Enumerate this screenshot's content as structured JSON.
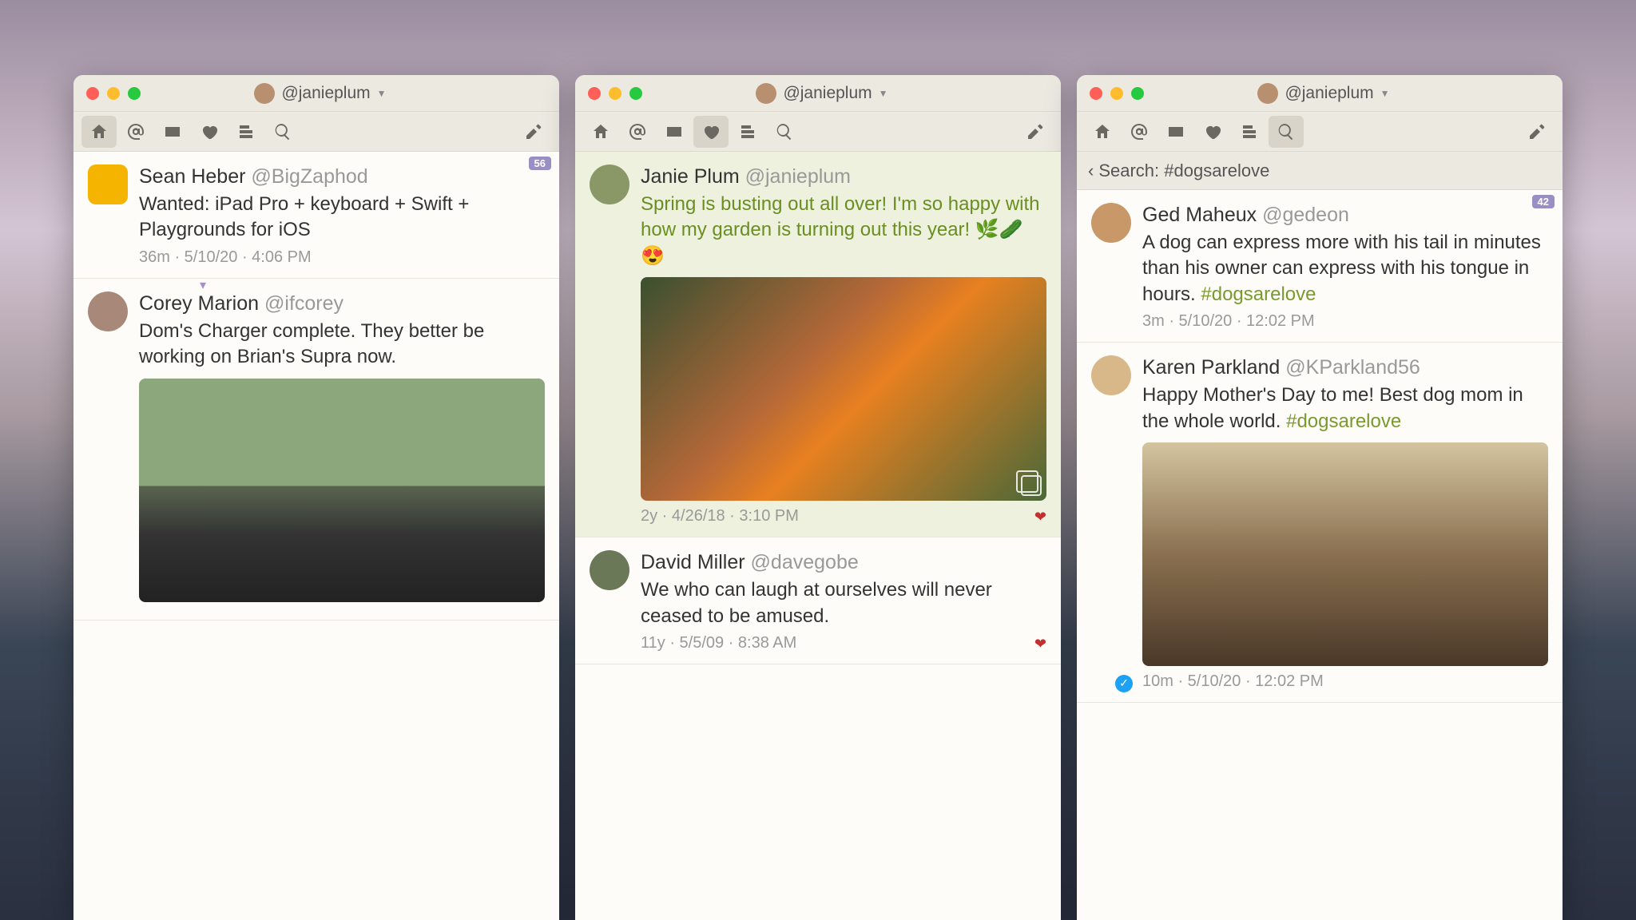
{
  "account_handle": "@janieplum",
  "windows": [
    {
      "badge": "56",
      "active_tab": "home",
      "tweets": [
        {
          "avatar_bg": "#f4b400",
          "avatar_shape": "sq",
          "name": "Sean Heber",
          "handle": "@BigZaphod",
          "text": "Wanted: iPad Pro + keyboard + Swift + Playgrounds for iOS",
          "meta": "36m · 5/10/20 · 4:06 PM"
        },
        {
          "avatar_bg": "#a88878",
          "avatar_shape": "c",
          "name": "Corey Marion",
          "handle": "@ifcorey",
          "text": "Dom's Charger complete. They better be working on Brian's Supra now.",
          "meta": "",
          "image": "car",
          "bookmark": true
        }
      ]
    },
    {
      "active_tab": "likes",
      "tweets": [
        {
          "avatar_bg": "#8a9868",
          "avatar_shape": "c",
          "name": "Janie Plum",
          "handle": "@janieplum",
          "text": "Spring is busting out all over! I'm so happy with how my garden is turning out this year! 🌿🥒😍",
          "meta": "2y · 4/26/18 · 3:10 PM",
          "image": "garden",
          "highlight": true,
          "green": true,
          "heart": true
        },
        {
          "avatar_bg": "#6a7858",
          "avatar_shape": "c",
          "name": "David Miller",
          "handle": "@davegobe",
          "text": "We who can laugh at ourselves will never ceased to be amused.",
          "meta": "11y · 5/5/09 · 8:38 AM",
          "heart": true
        }
      ]
    },
    {
      "active_tab": "search",
      "search_label": "Search: #dogsarelove",
      "badge": "42",
      "tweets": [
        {
          "avatar_bg": "#c89868",
          "avatar_shape": "c",
          "name": "Ged Maheux",
          "handle": "@gedeon",
          "text": "A dog can express more with his tail in minutes than his owner can express with his tongue in hours. ",
          "tag": "#dogsarelove",
          "meta": "3m · 5/10/20 · 12:02 PM"
        },
        {
          "avatar_bg": "#d8b888",
          "avatar_shape": "c",
          "name": "Karen Parkland",
          "handle": "@KParkland56",
          "text": "Happy Mother's Day to me! Best dog mom in the whole world.  ",
          "tag": "#dogsarelove",
          "meta": "10m · 5/10/20 · 12:02 PM",
          "image": "dog",
          "verified": true
        }
      ]
    }
  ]
}
